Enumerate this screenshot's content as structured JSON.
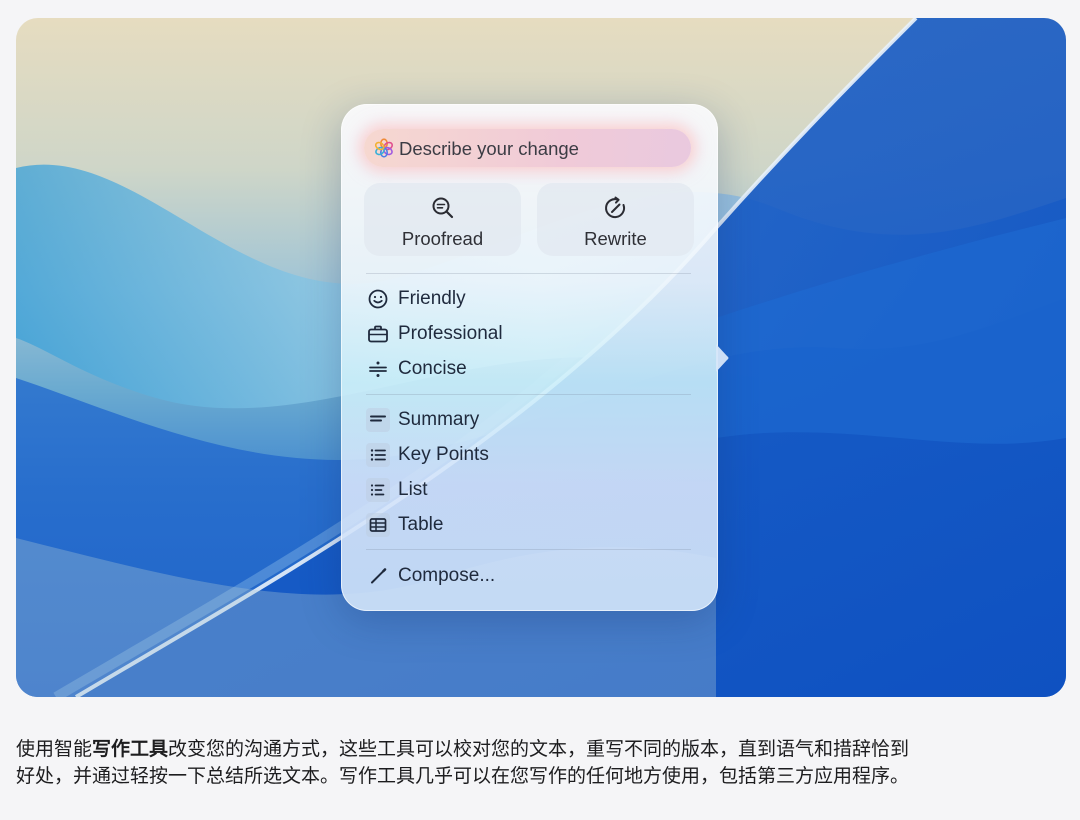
{
  "assistant_panel": {
    "describe_placeholder": "Describe your change",
    "buttons": [
      {
        "label": "Proofread",
        "icon": "magnifier-text-icon"
      },
      {
        "label": "Rewrite",
        "icon": "rewrite-arrow-icon"
      }
    ],
    "tone_items": [
      {
        "label": "Friendly",
        "icon": "smile-icon"
      },
      {
        "label": "Professional",
        "icon": "briefcase-icon"
      },
      {
        "label": "Concise",
        "icon": "divide-icon"
      }
    ],
    "format_items": [
      {
        "label": "Summary",
        "icon": "summary-icon"
      },
      {
        "label": "Key Points",
        "icon": "key-points-icon"
      },
      {
        "label": "List",
        "icon": "list-icon"
      },
      {
        "label": "Table",
        "icon": "table-icon"
      }
    ],
    "compose_item": {
      "label": "Compose...",
      "icon": "pen-icon"
    }
  },
  "caption": {
    "before": "使用智能",
    "bold": "写作工具",
    "after": "改变您的沟通方式，这些工具可以校对您的文本，重写不同的版本，直到语气和措辞恰到好处，并通过轻按一下总结所选文本。写作工具几乎可以在您写作的任何地方使用，包括第三方应用程序。"
  },
  "colors": {
    "accent_blue": "#2f72cc",
    "panel_text": "#1f2a3d",
    "describe_glow": "#f6d6ce"
  }
}
